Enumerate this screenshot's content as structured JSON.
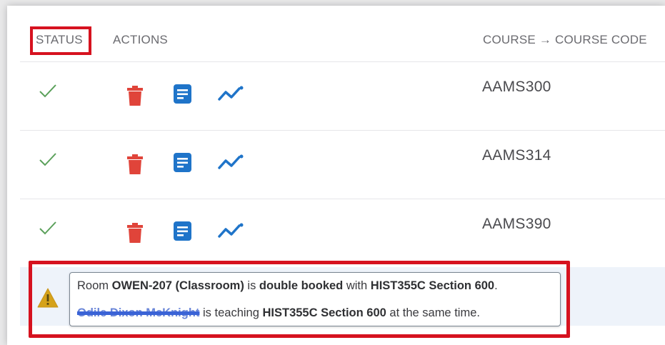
{
  "table": {
    "headers": {
      "status": "STATUS",
      "actions": "ACTIONS",
      "course_code": "COURSE → COURSE CODE"
    },
    "rows": [
      {
        "status": "check-icon",
        "code": "AAMS300"
      },
      {
        "status": "check-icon",
        "code": "AAMS314"
      },
      {
        "status": "check-icon",
        "code": "AAMS390"
      }
    ],
    "row_actions": [
      "trash-icon",
      "document-icon",
      "trend-icon"
    ]
  },
  "warning": {
    "icon": "warning-icon",
    "line1": {
      "t1": "Room ",
      "room": "OWEN-207 (Classroom)",
      "t2": " is ",
      "double_booked": "double booked",
      "t3": " with ",
      "section": "HIST355C Section 600",
      "t4": "."
    },
    "line2": {
      "instructor": "Odile Dixon McKnight",
      "t1": " is teaching ",
      "section": "HIST355C Section 600",
      "t2": " at the same time."
    }
  },
  "colors": {
    "highlight_border": "#d6121f",
    "check_green": "#5aa05a",
    "trash_red": "#e0443a",
    "action_blue": "#1f74c9",
    "warning_yellow": "#d5a21a"
  }
}
